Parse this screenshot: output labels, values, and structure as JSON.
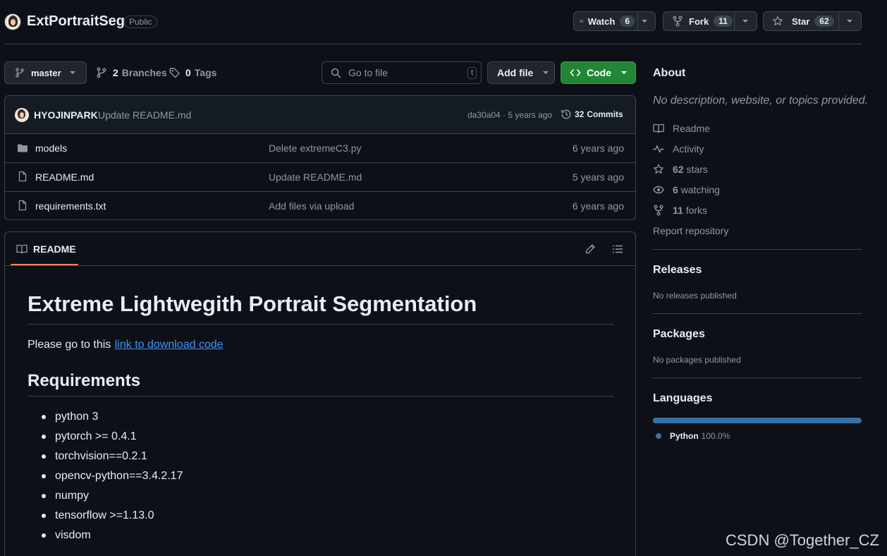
{
  "repo": {
    "name": "ExtPortraitSeg",
    "visibility": "Public"
  },
  "header_actions": {
    "watch_label": "Watch",
    "watch_count": "6",
    "fork_label": "Fork",
    "fork_count": "11",
    "star_label": "Star",
    "star_count": "62"
  },
  "toolbar": {
    "branch": "master",
    "branches_count": "2",
    "branches_label": "Branches",
    "tags_count": "0",
    "tags_label": "Tags",
    "goto_placeholder": "Go to file",
    "goto_shortcut": "t",
    "add_file_label": "Add file",
    "code_label": "Code"
  },
  "commit": {
    "author": "HYOJINPARK",
    "message": "Update README.md",
    "hash_time": "da30a04 · 5 years ago",
    "commits_count": "32",
    "commits_label": "Commits"
  },
  "files": [
    {
      "name": "models",
      "type": "folder",
      "message": "Delete extremeC3.py",
      "time": "6 years ago"
    },
    {
      "name": "README.md",
      "type": "file",
      "message": "Update README.md",
      "time": "5 years ago"
    },
    {
      "name": "requirements.txt",
      "type": "file",
      "message": "Add files via upload",
      "time": "6 years ago"
    }
  ],
  "readme": {
    "tab_label": "README",
    "title": "Extreme Lightwegith Portrait Segmentation",
    "intro_text": "Please go to this",
    "intro_link": "link to download code",
    "requirements_heading": "Requirements",
    "requirements": [
      "python 3",
      "pytorch >= 0.4.1",
      "torchvision==0.2.1",
      "opencv-python==3.4.2.17",
      "numpy",
      "tensorflow >=1.13.0",
      "visdom"
    ]
  },
  "about": {
    "heading": "About",
    "description": "No description, website, or topics provided.",
    "readme_label": "Readme",
    "activity_label": "Activity",
    "stars_count": "62",
    "stars_label": "stars",
    "watching_count": "6",
    "watching_label": "watching",
    "forks_count": "11",
    "forks_label": "forks",
    "report_label": "Report repository"
  },
  "releases": {
    "heading": "Releases",
    "text": "No releases published"
  },
  "packages": {
    "heading": "Packages",
    "text": "No packages published"
  },
  "languages": {
    "heading": "Languages",
    "items": [
      {
        "name": "Python",
        "percent": "100.0%",
        "color": "#3572A5"
      }
    ]
  },
  "watermark": "CSDN @Together_CZ",
  "colors": {
    "background": "#0d1117",
    "border": "#3d444d",
    "code_button": "#238636",
    "link": "#4493f8",
    "readme_tab_underline": "#f78166"
  }
}
